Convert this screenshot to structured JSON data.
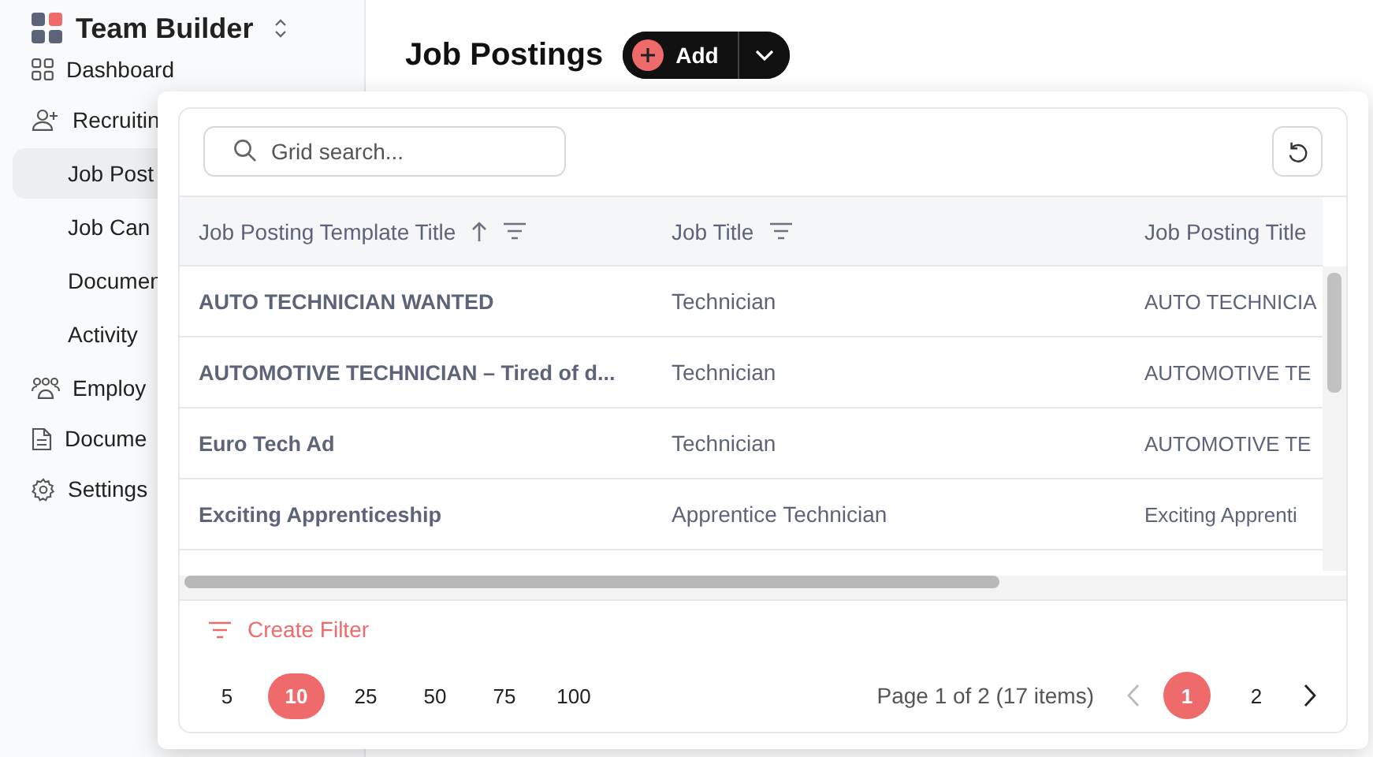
{
  "app": {
    "title": "Team Builder"
  },
  "sidebar": {
    "items": [
      {
        "label": "Dashboard",
        "selected": false
      },
      {
        "label": "Recruitin",
        "selected": false,
        "children": [
          {
            "label": "Job Post",
            "selected": true
          },
          {
            "label": "Job Can",
            "selected": false
          },
          {
            "label": "Documen",
            "selected": false
          },
          {
            "label": "Activity",
            "selected": false
          }
        ]
      },
      {
        "label": "Employ",
        "selected": false
      },
      {
        "label": "Docume",
        "selected": false
      },
      {
        "label": "Settings",
        "selected": false
      }
    ]
  },
  "page": {
    "title": "Job Postings",
    "add_button": "Add"
  },
  "grid": {
    "search": {
      "placeholder": "Grid search..."
    },
    "columns": [
      {
        "label": "Job Posting Template Title",
        "sorted": true,
        "filter": true
      },
      {
        "label": "Job Title",
        "sorted": false,
        "filter": true
      },
      {
        "label": "Job Posting Title"
      }
    ],
    "rows": [
      [
        "AUTO TECHNICIAN WANTED",
        "Technician",
        "AUTO TECHNICIA"
      ],
      [
        "AUTOMOTIVE TECHNICIAN – Tired of d...",
        "Technician",
        "AUTOMOTIVE TE"
      ],
      [
        "Euro Tech Ad",
        "Technician",
        "AUTOMOTIVE TE"
      ],
      [
        "Exciting Apprenticeship",
        "Apprentice Technician",
        "Exciting Apprenti"
      ]
    ],
    "create_filter": "Create Filter",
    "page_sizes": [
      {
        "label": "5",
        "selected": false
      },
      {
        "label": "10",
        "selected": true
      },
      {
        "label": "25",
        "selected": false
      },
      {
        "label": "50",
        "selected": false
      },
      {
        "label": "75",
        "selected": false
      },
      {
        "label": "100",
        "selected": false
      }
    ],
    "page_info": "Page 1 of 2 (17 items)",
    "pages": [
      {
        "label": "1",
        "selected": true
      },
      {
        "label": "2",
        "selected": false
      }
    ]
  }
}
